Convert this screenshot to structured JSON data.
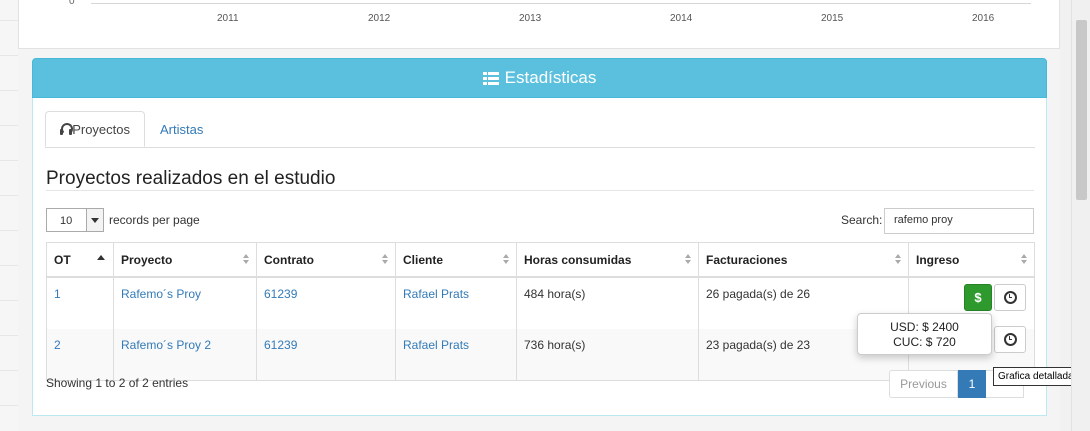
{
  "chart": {
    "zero_label": "0",
    "x_labels": [
      "2011",
      "2012",
      "2013",
      "2014",
      "2015",
      "2016"
    ]
  },
  "panel": {
    "title": "Estadísticas",
    "icon": "list-icon"
  },
  "tabs": [
    {
      "label": "Proyectos",
      "icon": "headphones-icon",
      "active": true
    },
    {
      "label": "Artistas",
      "active": false
    }
  ],
  "section_title": "Proyectos realizados en el estudio",
  "controls": {
    "page_length": "10",
    "records_label": "records per page",
    "search_label": "Search:",
    "search_value": "rafemo proy"
  },
  "table": {
    "columns": [
      "OT",
      "Proyecto",
      "Contrato",
      "Cliente",
      "Horas consumidas",
      "Facturaciones",
      "Ingreso"
    ],
    "rows": [
      {
        "ot": "1",
        "proyecto": "Rafemo´s Proy",
        "contrato": "61239",
        "cliente": "Rafael Prats",
        "horas": "484 hora(s)",
        "facturaciones": "26 pagada(s) de 26"
      },
      {
        "ot": "2",
        "proyecto": "Rafemo´s Proy 2",
        "contrato": "61239",
        "cliente": "Rafael Prats",
        "horas": "736 hora(s)",
        "facturaciones": "23 pagada(s) de 23"
      }
    ],
    "dollar_label": "$"
  },
  "popover": {
    "usd": "USD: $ 2400",
    "cuc": "CUC: $ 720"
  },
  "tooltip": "Grafica detallada",
  "footer": {
    "info": "Showing 1 to 2 of 2 entries",
    "previous": "Previous",
    "current_page": "1"
  },
  "colors": {
    "accent": "#5bc0de",
    "link": "#337ab7",
    "success": "#2e9a2e"
  }
}
